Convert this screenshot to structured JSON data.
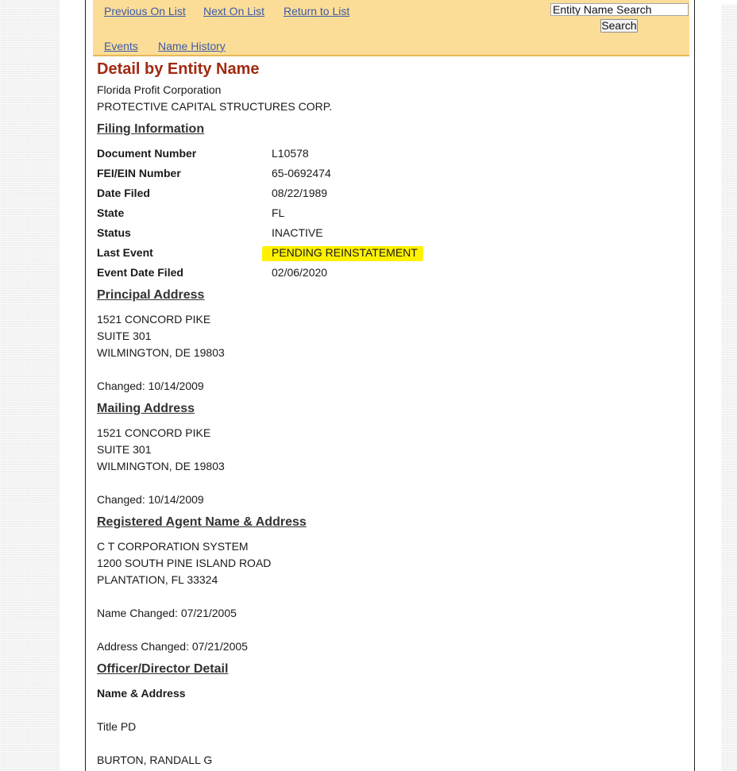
{
  "nav": {
    "previous": "Previous On List",
    "next": "Next On List",
    "return": "Return to List",
    "events": "Events",
    "name_history": "Name History",
    "search_placeholder": "Entity Name Search",
    "search_button": "Search"
  },
  "title": "Detail by Entity Name",
  "entity_type": "Florida Profit Corporation",
  "entity_name": "PROTECTIVE CAPITAL STRUCTURES CORP.",
  "filing": {
    "heading": "Filing Information",
    "rows": [
      {
        "label": "Document Number",
        "value": "L10578"
      },
      {
        "label": "FEI/EIN Number",
        "value": "65-0692474"
      },
      {
        "label": "Date Filed",
        "value": "08/22/1989"
      },
      {
        "label": "State",
        "value": "FL"
      },
      {
        "label": "Status",
        "value": "INACTIVE"
      },
      {
        "label": "Last Event",
        "value": "PENDING REINSTATEMENT"
      },
      {
        "label": "Event Date Filed",
        "value": "02/06/2020"
      }
    ]
  },
  "principal": {
    "heading": "Principal Address",
    "lines": [
      "1521 CONCORD PIKE",
      "SUITE 301",
      "WILMINGTON, DE 19803"
    ],
    "changed": "Changed: 10/14/2009"
  },
  "mailing": {
    "heading": "Mailing Address",
    "lines": [
      "1521 CONCORD PIKE",
      "SUITE 301",
      "WILMINGTON, DE 19803"
    ],
    "changed": "Changed: 10/14/2009"
  },
  "agent": {
    "heading": "Registered Agent Name & Address",
    "lines": [
      "C T CORPORATION SYSTEM",
      "1200 SOUTH PINE ISLAND ROAD",
      "PLANTATION, FL 33324"
    ],
    "name_changed": "Name Changed: 07/21/2005",
    "address_changed": "Address Changed: 07/21/2005"
  },
  "officer": {
    "heading": "Officer/Director Detail",
    "subheading": "Name & Address",
    "title": "Title PD",
    "name": "BURTON, RANDALL G"
  },
  "colors": {
    "nav_background": "#fcdd97",
    "title": "#a12a12",
    "link": "#3c5aa8",
    "highlight": "#fff100"
  }
}
